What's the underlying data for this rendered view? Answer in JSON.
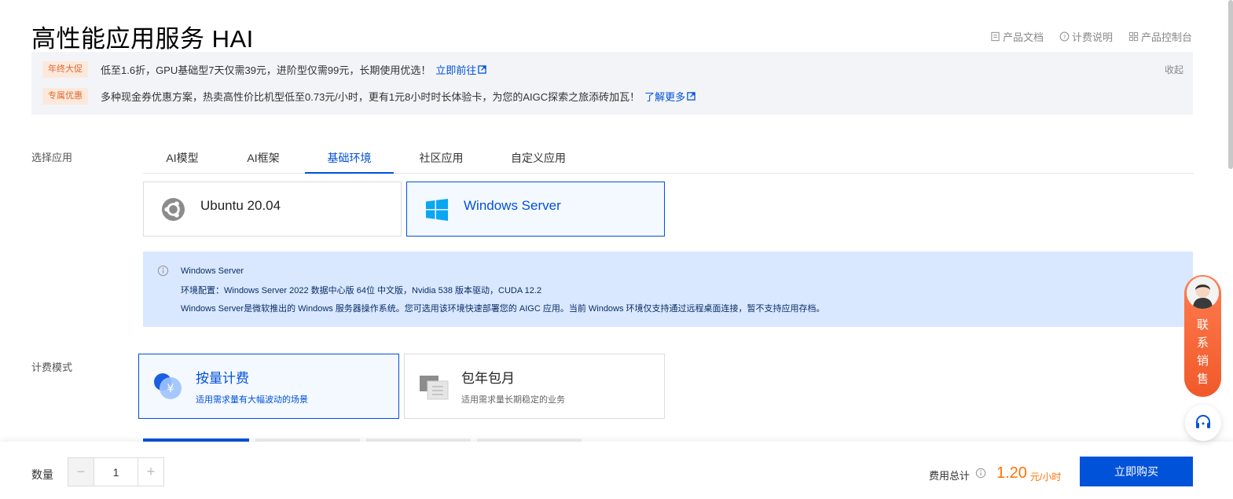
{
  "title": "高性能应用服务 HAI",
  "top_links": [
    {
      "label": "产品文档",
      "icon": "doc-icon"
    },
    {
      "label": "计费说明",
      "icon": "help-circle-icon"
    },
    {
      "label": "产品控制台",
      "icon": "grid-icon"
    }
  ],
  "promo": {
    "row1": {
      "tag": "年终大促",
      "text": "低至1.6折，GPU基础型7天仅需39元，进阶型仅需99元，长期使用优选！",
      "link": "立即前往"
    },
    "row2": {
      "tag": "专属优惠",
      "text": "多种现金券优惠方案，热卖高性价比机型低至0.73元/小时，更有1元8小时时长体验卡，为您的AIGC探索之旅添砖加瓦！",
      "link": "了解更多"
    },
    "collapse": "收起"
  },
  "select_app": {
    "label": "选择应用",
    "tabs": [
      "AI模型",
      "AI框架",
      "基础环境",
      "社区应用",
      "自定义应用"
    ],
    "active_tab": "基础环境",
    "options": [
      {
        "name": "Ubuntu 20.04",
        "icon": "ubuntu-icon",
        "selected": false
      },
      {
        "name": "Windows Server",
        "icon": "windows-icon",
        "selected": true
      }
    ]
  },
  "info": {
    "title": "Windows Server",
    "config": "环境配置：Windows Server 2022 数据中心版 64位 中文版，Nvidia 538 版本驱动，CUDA 12.2",
    "desc": "Windows Server是微软推出的 Windows 服务器操作系统。您可选用该环境快速部署您的 AIGC 应用。当前 Windows 环境仅支持通过远程桌面连接，暂不支持应用存档。"
  },
  "billing": {
    "label": "计费模式",
    "options": [
      {
        "title": "按量计费",
        "desc": "适用需求量有大幅波动的场景",
        "icon": "yuan-coin-icon",
        "selected": true
      },
      {
        "title": "包年包月",
        "desc": "适用需求量长期稳定的业务",
        "icon": "calendar-icon",
        "selected": false
      }
    ]
  },
  "footer": {
    "qty_label": "数量",
    "qty_value": "1",
    "minus": "−",
    "plus": "+",
    "total_label": "费用总计",
    "price": "1.20",
    "price_unit": "元/小时",
    "buy": "立即购买"
  },
  "float": {
    "contact": "联系销售"
  },
  "colors": {
    "primary": "#0052d9",
    "price": "#ff7200",
    "promo_tag": "#e0672e",
    "info_bg": "#d9e8ff"
  }
}
